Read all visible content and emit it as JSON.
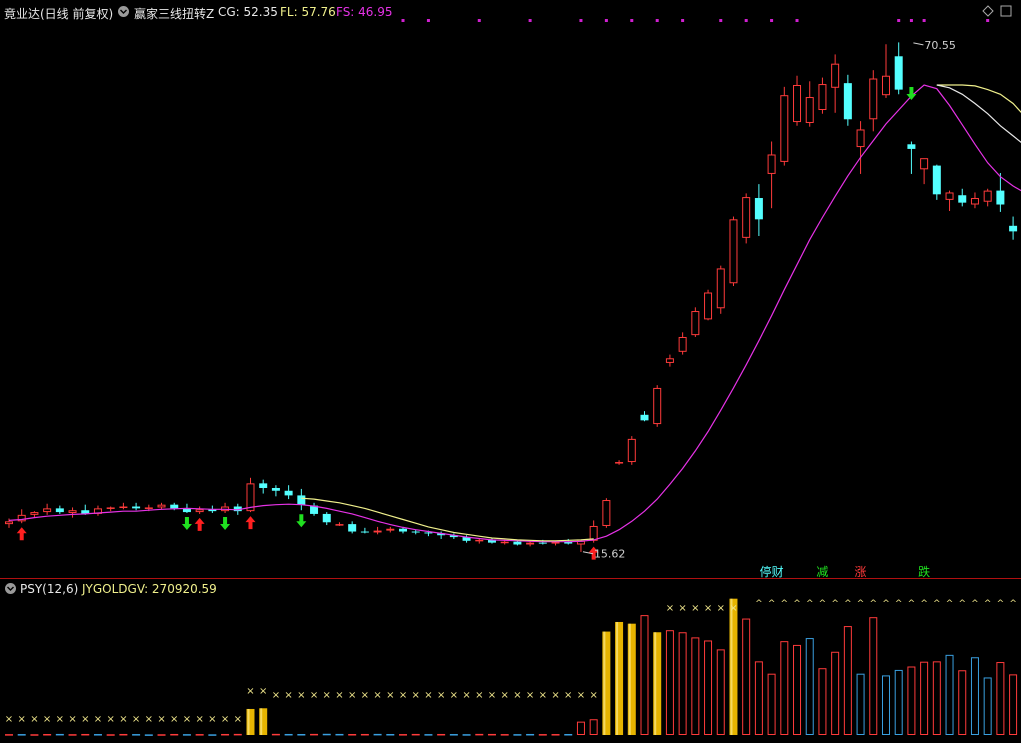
{
  "header": {
    "stock_label": "竟业达(日线 前复权)",
    "indicator_name": "赢家三线扭转Z",
    "cg_label": "CG: 52.35",
    "fl_label": "FL: 57.76",
    "fs_label": "FS: 46.95"
  },
  "sub_header": {
    "indicator_name": "PSY(12,6)",
    "value_label": "JYGOLDGV: 270920.59"
  },
  "colors": {
    "bg": "#000000",
    "up": "#ff3b3b",
    "down": "#54ffff",
    "ma_main": "#e632e6",
    "ma_yellow": "#f0f08c",
    "ma_white": "#e8e8e8",
    "gold": "#e6b400",
    "marker_dot": "#d020d0",
    "cross": "#f0e68c",
    "divider": "#b01010",
    "arrow_up": "#ff2020",
    "arrow_down": "#20e020"
  },
  "icons": {
    "collapse": "circle-chevron-icon",
    "settings": "diamond-icon",
    "expand": "square-icon"
  },
  "chart_data": [
    {
      "type": "candlestick",
      "title": "竟业达(日线 前复权)",
      "candles": [
        {
          "o": 18.6,
          "h": 19.2,
          "l": 18.2,
          "c": 18.9
        },
        {
          "o": 18.9,
          "h": 20.2,
          "l": 18.7,
          "c": 19.6
        },
        {
          "o": 19.6,
          "h": 20.0,
          "l": 19.3,
          "c": 19.9
        },
        {
          "o": 19.9,
          "h": 20.8,
          "l": 19.6,
          "c": 20.3
        },
        {
          "o": 20.3,
          "h": 20.6,
          "l": 19.7,
          "c": 19.9
        },
        {
          "o": 19.8,
          "h": 20.4,
          "l": 19.3,
          "c": 20.1
        },
        {
          "o": 20.1,
          "h": 20.7,
          "l": 19.6,
          "c": 19.7
        },
        {
          "o": 19.7,
          "h": 20.6,
          "l": 19.5,
          "c": 20.3
        },
        {
          "o": 20.3,
          "h": 20.5,
          "l": 20.0,
          "c": 20.4
        },
        {
          "o": 20.4,
          "h": 20.9,
          "l": 20.2,
          "c": 20.5
        },
        {
          "o": 20.5,
          "h": 20.9,
          "l": 20.1,
          "c": 20.3
        },
        {
          "o": 20.3,
          "h": 20.7,
          "l": 20.0,
          "c": 20.4
        },
        {
          "o": 20.4,
          "h": 20.9,
          "l": 20.2,
          "c": 20.7
        },
        {
          "o": 20.7,
          "h": 20.9,
          "l": 20.1,
          "c": 20.3
        },
        {
          "o": 20.3,
          "h": 20.8,
          "l": 19.8,
          "c": 19.9
        },
        {
          "o": 19.9,
          "h": 20.5,
          "l": 19.7,
          "c": 20.2
        },
        {
          "o": 20.2,
          "h": 20.6,
          "l": 19.8,
          "c": 20.0
        },
        {
          "o": 20.0,
          "h": 20.9,
          "l": 19.8,
          "c": 20.5
        },
        {
          "o": 20.5,
          "h": 20.8,
          "l": 19.6,
          "c": 20.0
        },
        {
          "o": 20.0,
          "h": 23.6,
          "l": 19.9,
          "c": 23.0
        },
        {
          "o": 23.0,
          "h": 23.4,
          "l": 21.9,
          "c": 22.5
        },
        {
          "o": 22.5,
          "h": 22.8,
          "l": 21.6,
          "c": 22.2
        },
        {
          "o": 22.2,
          "h": 22.8,
          "l": 21.3,
          "c": 21.7
        },
        {
          "o": 21.7,
          "h": 22.4,
          "l": 20.1,
          "c": 20.7
        },
        {
          "o": 20.6,
          "h": 20.9,
          "l": 19.5,
          "c": 19.7
        },
        {
          "o": 19.7,
          "h": 19.9,
          "l": 18.5,
          "c": 18.8
        },
        {
          "o": 18.5,
          "h": 18.8,
          "l": 18.4,
          "c": 18.6
        },
        {
          "o": 18.6,
          "h": 18.9,
          "l": 17.6,
          "c": 17.8
        },
        {
          "o": 17.8,
          "h": 18.2,
          "l": 17.6,
          "c": 17.7
        },
        {
          "o": 17.7,
          "h": 18.3,
          "l": 17.5,
          "c": 17.9
        },
        {
          "o": 17.9,
          "h": 18.3,
          "l": 17.7,
          "c": 18.1
        },
        {
          "o": 18.1,
          "h": 18.3,
          "l": 17.6,
          "c": 17.8
        },
        {
          "o": 17.8,
          "h": 18.0,
          "l": 17.5,
          "c": 17.7
        },
        {
          "o": 17.7,
          "h": 17.9,
          "l": 17.3,
          "c": 17.6
        },
        {
          "o": 17.6,
          "h": 17.8,
          "l": 17.0,
          "c": 17.4
        },
        {
          "o": 17.4,
          "h": 17.6,
          "l": 17.0,
          "c": 17.2
        },
        {
          "o": 17.2,
          "h": 17.4,
          "l": 16.6,
          "c": 16.8
        },
        {
          "o": 16.8,
          "h": 17.0,
          "l": 16.5,
          "c": 16.9
        },
        {
          "o": 16.9,
          "h": 17.1,
          "l": 16.5,
          "c": 16.6
        },
        {
          "o": 16.6,
          "h": 16.9,
          "l": 16.4,
          "c": 16.7
        },
        {
          "o": 16.7,
          "h": 16.9,
          "l": 16.3,
          "c": 16.4
        },
        {
          "o": 16.4,
          "h": 16.8,
          "l": 16.2,
          "c": 16.6
        },
        {
          "o": 16.6,
          "h": 16.9,
          "l": 16.4,
          "c": 16.5
        },
        {
          "o": 16.5,
          "h": 16.8,
          "l": 16.3,
          "c": 16.7
        },
        {
          "o": 16.7,
          "h": 17.0,
          "l": 16.4,
          "c": 16.5
        },
        {
          "o": 16.4,
          "h": 16.9,
          "l": 15.6,
          "c": 16.8
        },
        {
          "o": 16.8,
          "h": 19.0,
          "l": 16.6,
          "c": 18.4
        },
        {
          "o": 18.4,
          "h": 21.4,
          "l": 18.2,
          "c": 21.2
        },
        {
          "o": 25.2,
          "h": 25.5,
          "l": 25.0,
          "c": 25.3
        },
        {
          "o": 25.3,
          "h": 28.1,
          "l": 25.0,
          "c": 27.8
        },
        {
          "o": 30.4,
          "h": 30.8,
          "l": 29.7,
          "c": 29.8
        },
        {
          "o": 29.4,
          "h": 33.6,
          "l": 29.1,
          "c": 33.3
        },
        {
          "o": 36.0,
          "h": 36.9,
          "l": 35.6,
          "c": 36.5
        },
        {
          "o": 37.2,
          "h": 39.3,
          "l": 36.9,
          "c": 38.8
        },
        {
          "o": 39.0,
          "h": 42.0,
          "l": 38.8,
          "c": 41.6
        },
        {
          "o": 40.7,
          "h": 43.9,
          "l": 40.6,
          "c": 43.6
        },
        {
          "o": 41.9,
          "h": 46.5,
          "l": 41.3,
          "c": 46.2
        },
        {
          "o": 44.6,
          "h": 51.8,
          "l": 44.3,
          "c": 51.5
        },
        {
          "o": 49.5,
          "h": 54.3,
          "l": 48.9,
          "c": 53.9
        },
        {
          "o": 53.8,
          "h": 55.3,
          "l": 49.7,
          "c": 51.5
        },
        {
          "o": 56.4,
          "h": 59.9,
          "l": 52.7,
          "c": 58.5
        },
        {
          "o": 57.7,
          "h": 65.8,
          "l": 57.3,
          "c": 64.9
        },
        {
          "o": 62.0,
          "h": 67.0,
          "l": 61.6,
          "c": 66.0
        },
        {
          "o": 61.9,
          "h": 66.4,
          "l": 61.5,
          "c": 64.7
        },
        {
          "o": 63.3,
          "h": 66.8,
          "l": 62.9,
          "c": 66.1
        },
        {
          "o": 65.7,
          "h": 69.3,
          "l": 63.0,
          "c": 68.3
        },
        {
          "o": 66.2,
          "h": 67.1,
          "l": 61.6,
          "c": 62.3
        },
        {
          "o": 59.3,
          "h": 62.1,
          "l": 56.4,
          "c": 61.2
        },
        {
          "o": 62.3,
          "h": 67.6,
          "l": 61.0,
          "c": 66.7
        },
        {
          "o": 64.9,
          "h": 70.4,
          "l": 64.6,
          "c": 67.0
        },
        {
          "o": 69.1,
          "h": 70.6,
          "l": 65.0,
          "c": 65.5
        },
        {
          "o": 59.6,
          "h": 59.9,
          "l": 56.4,
          "c": 59.1
        },
        {
          "o": 56.9,
          "h": 58.0,
          "l": 55.3,
          "c": 58.1
        },
        {
          "o": 57.3,
          "h": 57.4,
          "l": 53.6,
          "c": 54.2
        },
        {
          "o": 53.6,
          "h": 54.6,
          "l": 52.4,
          "c": 54.4
        },
        {
          "o": 54.1,
          "h": 54.8,
          "l": 52.9,
          "c": 53.3
        },
        {
          "o": 53.1,
          "h": 54.4,
          "l": 52.7,
          "c": 53.8
        },
        {
          "o": 53.4,
          "h": 54.8,
          "l": 52.9,
          "c": 54.6
        },
        {
          "o": 54.6,
          "h": 56.5,
          "l": 52.3,
          "c": 53.1
        },
        {
          "o": 50.8,
          "h": 51.8,
          "l": 49.3,
          "c": 50.2
        }
      ],
      "ma_main": [
        19.0,
        19.1,
        19.3,
        19.45,
        19.55,
        19.65,
        19.7,
        19.8,
        19.9,
        20.0,
        20.0,
        20.1,
        20.2,
        20.25,
        20.3,
        20.25,
        20.2,
        20.2,
        20.15,
        20.4,
        20.6,
        20.7,
        20.75,
        20.7,
        20.55,
        20.3,
        20.0,
        19.7,
        19.3,
        18.9,
        18.55,
        18.25,
        18.0,
        17.8,
        17.6,
        17.4,
        17.2,
        17.05,
        16.9,
        16.85,
        16.8,
        16.75,
        16.7,
        16.7,
        16.7,
        16.75,
        16.9,
        17.3,
        18.0,
        18.9,
        20.0,
        21.3,
        22.9,
        24.6,
        26.5,
        28.6,
        30.9,
        33.3,
        35.8,
        38.4,
        41.1,
        43.9,
        46.6,
        49.3,
        51.7,
        54.0,
        56.2,
        58.2,
        60.0,
        61.8,
        63.3,
        64.8,
        66.0,
        65.6,
        63.8,
        61.7,
        59.6,
        57.6,
        56.1,
        55.1,
        54.3,
        53.1,
        51.4
      ],
      "ma_yellow_start": 23,
      "ma_yellow": [
        21.4,
        21.3,
        21.1,
        20.9,
        20.6,
        20.3,
        19.9,
        19.5,
        19.1,
        18.7,
        18.3,
        18.0,
        17.7,
        17.5,
        17.3,
        17.1,
        17.0,
        16.9,
        16.85,
        16.8,
        16.8,
        16.85,
        16.9,
        17.0
      ],
      "ma_yellow2_start": 73,
      "ma_yellow2": [
        66.0,
        66.0,
        66.0,
        65.9,
        65.5,
        65.0,
        64.0,
        62.5,
        61.0,
        59.5
      ],
      "ma_white_start": 73,
      "ma_white": [
        66.0,
        65.7,
        65.0,
        64.0,
        62.9,
        61.6,
        60.5,
        59.4,
        57.6,
        56.0
      ],
      "price_range": [
        13.0,
        72.8
      ],
      "annotations": [
        {
          "label": "70.55",
          "index": 71,
          "value": 70.55
        },
        {
          "label": "15.62",
          "index": 45,
          "value": 15.62
        }
      ],
      "up_arrows": [
        1,
        15,
        19,
        46
      ],
      "down_arrows": [
        14,
        17,
        23,
        71
      ],
      "top_markers": [
        31,
        33,
        37,
        41,
        45,
        47,
        49,
        51,
        53,
        56,
        58,
        60,
        62,
        70,
        71,
        72,
        77,
        80
      ],
      "text_markers": [
        {
          "label": "停财",
          "index": 60,
          "color": "#54ffff"
        },
        {
          "label": "减",
          "index": 64,
          "color": "#20e020"
        },
        {
          "label": "涨",
          "index": 67,
          "color": "#ff3b3b"
        },
        {
          "label": "跌",
          "index": 72,
          "color": "#20e020"
        }
      ]
    },
    {
      "type": "bar",
      "title": "PSY(12,6)",
      "series_name": "JYGOLDGV",
      "value": 270920.59,
      "values": [
        0.25,
        0.27,
        0.22,
        0.29,
        0.31,
        0.24,
        0.3,
        0.28,
        0.22,
        0.3,
        0.27,
        0.18,
        0.22,
        0.3,
        0.25,
        0.27,
        0.2,
        0.3,
        0.32,
        7.6,
        7.8,
        0.33,
        0.3,
        0.29,
        0.32,
        0.35,
        0.31,
        0.29,
        0.3,
        0.32,
        0.29,
        0.27,
        0.31,
        0.26,
        0.3,
        0.28,
        0.24,
        0.32,
        0.31,
        0.27,
        0.25,
        0.3,
        0.27,
        0.28,
        0.29,
        3.9,
        4.6,
        30.2,
        33.0,
        32.5,
        35.0,
        30.0,
        30.6,
        30.0,
        28.5,
        27.6,
        25.0,
        39.8,
        34.0,
        21.5,
        17.9,
        27.4,
        26.3,
        28.3,
        19.5,
        24.3,
        31.8,
        17.9,
        34.4,
        17.4,
        19.0,
        20.0,
        21.4,
        21.5,
        23.4,
        18.9,
        22.7,
        16.8,
        21.3,
        17.7,
        18.2
      ],
      "colors": [
        "u",
        "d",
        "u",
        "u",
        "d",
        "u",
        "u",
        "d",
        "u",
        "u",
        "d",
        "d",
        "u",
        "u",
        "d",
        "u",
        "d",
        "u",
        "u",
        "g",
        "g",
        "u",
        "d",
        "d",
        "u",
        "d",
        "d",
        "u",
        "u",
        "d",
        "d",
        "u",
        "u",
        "d",
        "u",
        "d",
        "d",
        "u",
        "u",
        "u",
        "d",
        "d",
        "u",
        "u",
        "d",
        "u",
        "u",
        "g",
        "g",
        "g",
        "u",
        "g",
        "u",
        "u",
        "u",
        "u",
        "u",
        "g",
        "u",
        "u",
        "u",
        "u",
        "u",
        "d",
        "u",
        "u",
        "u",
        "d",
        "u",
        "d",
        "d",
        "u",
        "u",
        "u",
        "d",
        "u",
        "d",
        "d",
        "u",
        "u",
        "u"
      ],
      "range": [
        0,
        40
      ]
    }
  ]
}
